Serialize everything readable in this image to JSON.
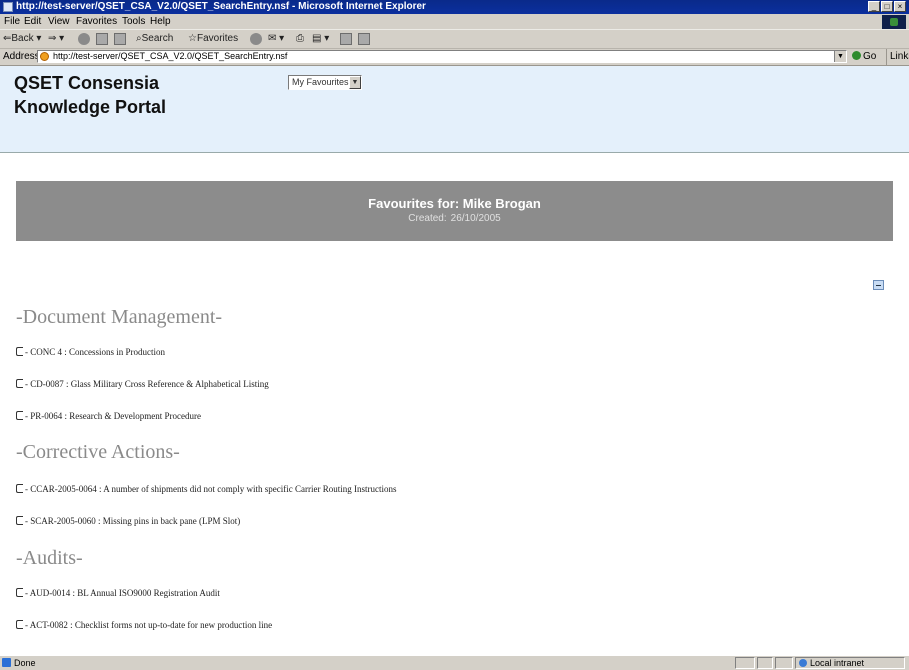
{
  "window": {
    "title": "http://test-server/QSET_CSA_V2.0/QSET_SearchEntry.nsf - Microsoft Internet Explorer",
    "buttons": {
      "minimize": "_",
      "maximize": "□",
      "close": "×"
    }
  },
  "menu": [
    "File",
    "Edit",
    "View",
    "Favorites",
    "Tools",
    "Help"
  ],
  "toolbar": {
    "back": "Back",
    "search": "Search",
    "favorites": "Favorites"
  },
  "address": {
    "label": "Address",
    "url": "http://test-server/QSET_CSA_V2.0/QSET_SearchEntry.nsf",
    "go": "Go",
    "links": "Links"
  },
  "header": {
    "portal_title_line1": "QSET Consensia",
    "portal_title_line2": "Knowledge Portal",
    "favourites_select": "My Favourites"
  },
  "banner": {
    "title": "Favourites for: Mike Brogan",
    "created_label": "Created:",
    "created_date": "26/10/2005"
  },
  "sections": [
    {
      "heading": "-Document Management-",
      "items": [
        "- CONC 4 : Concessions in Production",
        "- CD-0087 : Glass Military Cross Reference & Alphabetical Listing",
        "- PR-0064 : Research & Development Procedure"
      ]
    },
    {
      "heading": "-Corrective Actions-",
      "items": [
        "- CCAR-2005-0064 : A number of shipments did not comply with specific Carrier Routing Instructions",
        "- SCAR-2005-0060 : Missing pins in back pane (LPM Slot)"
      ]
    },
    {
      "heading": "-Audits-",
      "items": [
        "- AUD-0014 : BL Annual ISO9000 Registration Audit",
        "- ACT-0082 : Checklist forms not up-to-date for new production line"
      ]
    }
  ],
  "status": {
    "text": "Done",
    "zone": "Local intranet"
  }
}
